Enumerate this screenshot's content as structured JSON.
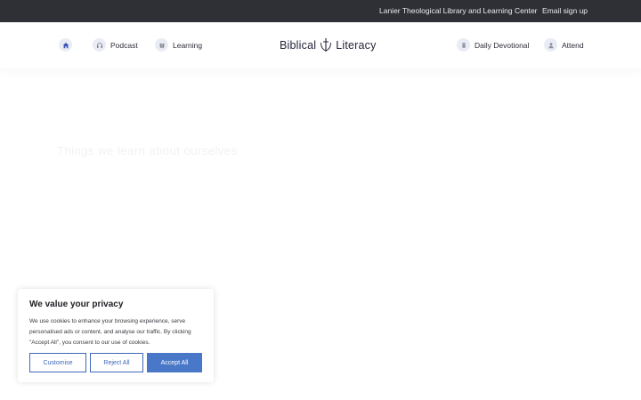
{
  "topbar": {
    "library_link": "Lanier Theological Library and Learning Center",
    "email_link": "Email sign up"
  },
  "nav": {
    "podcast": "Podcast",
    "learning": "Learning",
    "devotional": "Daily Devotional",
    "attend": "Attend",
    "icons": [
      "home-icon",
      "headphones-icon",
      "book-icon",
      "devotional-icon",
      "person-icon"
    ]
  },
  "logo": {
    "left": "Biblical",
    "right": "Literacy"
  },
  "page": {
    "faded_title": "Things we learn about ourselves"
  },
  "cookie": {
    "title": "We value your privacy",
    "body": "We use cookies to enhance your browsing experience, serve personalised ads or content, and analyse our traffic. By clicking \"Accept All\", you consent to our use of cookies.",
    "customise": "Customise",
    "reject": "Reject All",
    "accept": "Accept All"
  },
  "colors": {
    "topbar": "#2f3035",
    "accent": "#4a78c8",
    "icon_bg": "#e9ecf5"
  }
}
